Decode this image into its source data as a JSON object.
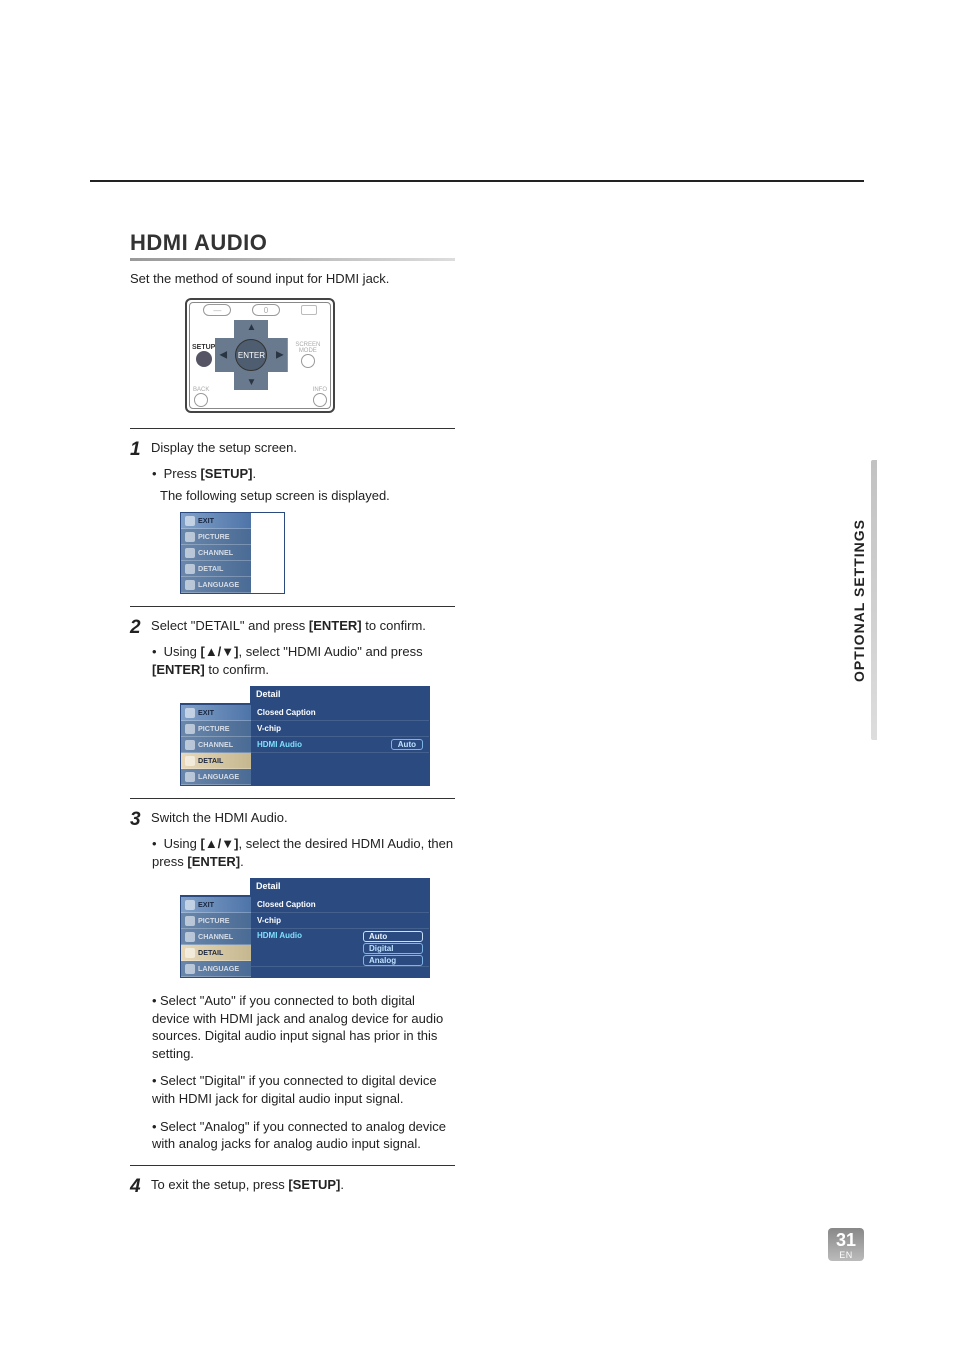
{
  "side_tab": "OPTIONAL SETTINGS",
  "page_number": "31",
  "page_suffix": "EN",
  "section": {
    "title": "HDMI AUDIO",
    "intro": "Set the method of sound input for HDMI jack."
  },
  "remote": {
    "setup_label": "SETUP",
    "zero_label": "0",
    "enter_label": "ENTER",
    "back_label": "BACK",
    "info_label": "INFO",
    "screen_label": "SCREEN MODE"
  },
  "steps": [
    {
      "num": "1",
      "text": "Display the setup screen.",
      "subs": [
        {
          "bulleted": true,
          "segments": [
            "Press ",
            {
              "bold": true,
              "text": "[SETUP]"
            },
            "."
          ]
        },
        {
          "bulleted": false,
          "segments": [
            "The following setup screen is displayed."
          ]
        }
      ],
      "osd": "menu1"
    },
    {
      "num": "2",
      "text_segments": [
        "Select \"DETAIL\" and press ",
        {
          "bold": true,
          "text": "[ENTER]"
        },
        " to confirm."
      ],
      "subs": [
        {
          "bulleted": true,
          "segments": [
            "Using ",
            {
              "bold": true,
              "text": "[▲/▼]"
            },
            ", select \"HDMI Audio\" and press ",
            {
              "bold": true,
              "text": "[ENTER]"
            },
            " to confirm."
          ]
        }
      ],
      "osd": "menu2"
    },
    {
      "num": "3",
      "text": "Switch the HDMI Audio.",
      "subs": [
        {
          "bulleted": true,
          "segments": [
            "Using ",
            {
              "bold": true,
              "text": "[▲/▼]"
            },
            ", select the desired HDMI Audio, then press ",
            {
              "bold": true,
              "text": "[ENTER]"
            },
            "."
          ]
        }
      ],
      "osd": "menu3",
      "after": [
        {
          "bulleted": true,
          "segments": [
            "Select \"Auto\" if you connected to both digital device with HDMI jack and analog device for audio sources. Digital audio input signal has prior in this setting."
          ]
        },
        {
          "bulleted": true,
          "segments": [
            "Select \"Digital\" if you connected to digital device with HDMI jack for digital audio input signal."
          ]
        },
        {
          "bulleted": true,
          "segments": [
            "Select \"Analog\" if you connected to analog device with analog jacks for analog audio input signal."
          ]
        }
      ]
    },
    {
      "num": "4",
      "text_segments": [
        "To exit the setup, press ",
        {
          "bold": true,
          "text": "[SETUP]"
        },
        "."
      ]
    }
  ],
  "osd_menus": {
    "left_items": [
      {
        "label": "EXIT"
      },
      {
        "label": "PICTURE"
      },
      {
        "label": "CHANNEL"
      },
      {
        "label": "DETAIL"
      },
      {
        "label": "LANGUAGE"
      }
    ],
    "panel_title": "Detail",
    "right_items": [
      "Closed Caption",
      "V-chip",
      "HDMI Audio"
    ],
    "hdmi_value": "Auto",
    "hdmi_options": [
      "Auto",
      "Digital",
      "Analog"
    ]
  }
}
